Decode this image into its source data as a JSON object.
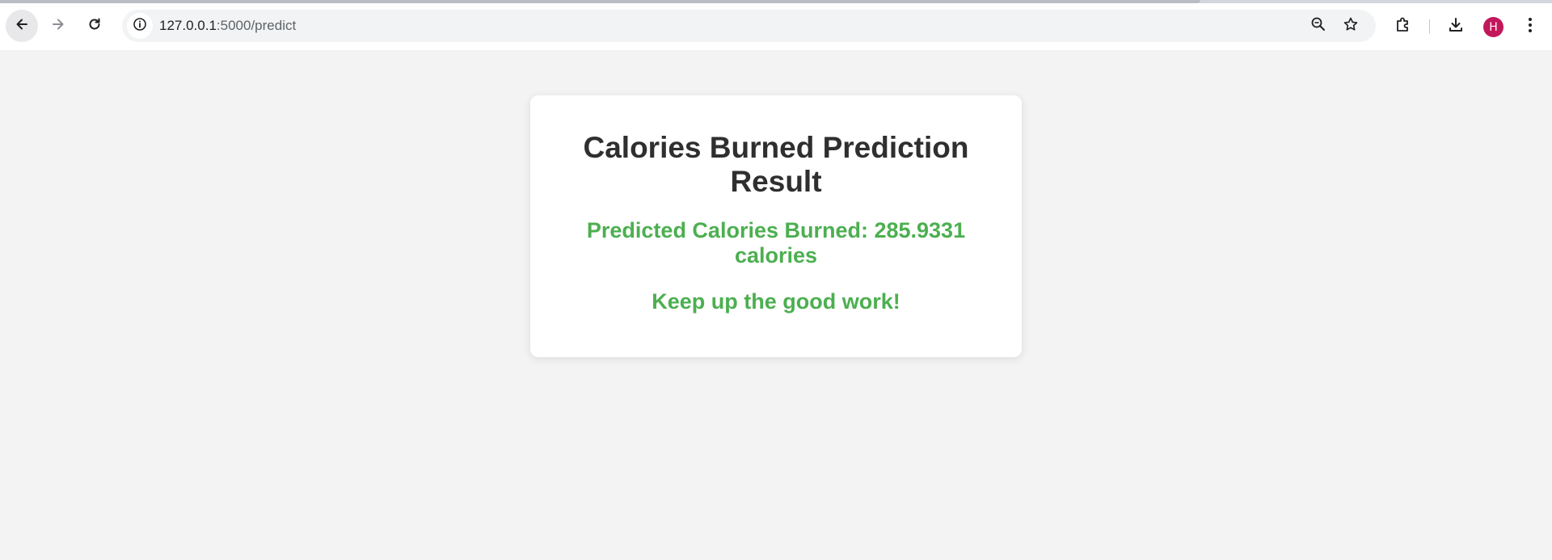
{
  "browser": {
    "url_host": "127.0.0.1",
    "url_path": ":5000/predict",
    "avatar_initial": "H",
    "avatar_color": "#c2185b",
    "icons": {
      "back": "back-arrow-icon",
      "forward": "forward-arrow-icon",
      "reload": "reload-icon",
      "site_info": "info-icon",
      "zoom": "zoom-out-icon",
      "bookmark": "star-icon",
      "extensions": "puzzle-piece-icon",
      "downloads": "download-icon",
      "menu": "kebab-menu-icon"
    }
  },
  "result": {
    "title": "Calories Burned Prediction Result",
    "prediction_text": "Predicted Calories Burned: 285.9331 calories",
    "motivation": "Keep up the good work!",
    "accent_color": "#4caf50",
    "title_color": "#2f2f2f"
  }
}
